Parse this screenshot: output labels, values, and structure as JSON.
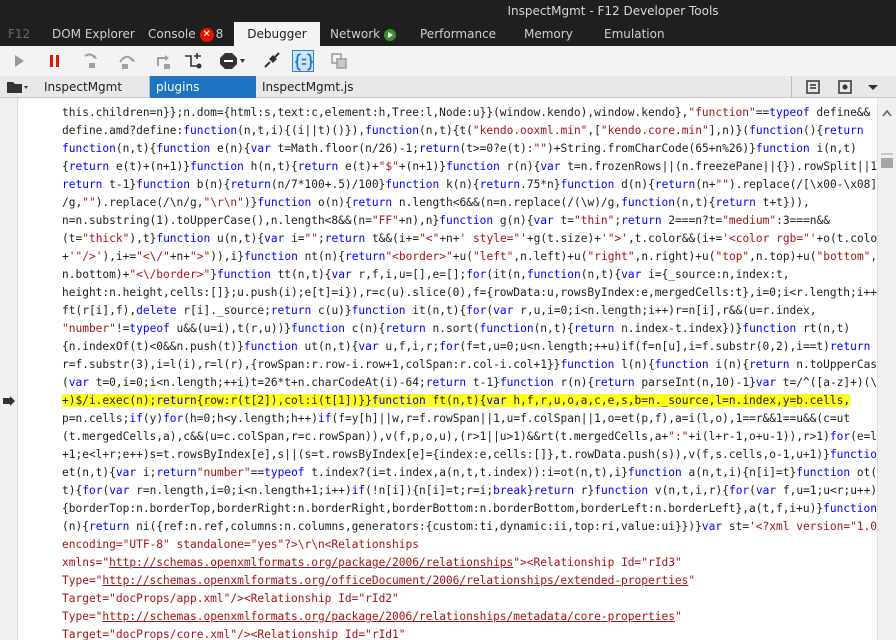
{
  "window": {
    "title": "InspectMgmt - F12 Developer Tools"
  },
  "tabs": [
    {
      "label": "F12"
    },
    {
      "label": "DOM Explorer"
    },
    {
      "label": "Console",
      "badge": "8"
    },
    {
      "label": "Debugger"
    },
    {
      "label": "Network"
    },
    {
      "label": "Performance"
    },
    {
      "label": "Memory"
    },
    {
      "label": "Emulation"
    }
  ],
  "toolbar": {
    "icons": [
      "play-icon",
      "pause-icon",
      "step-into-icon",
      "step-over-icon",
      "step-out-icon",
      "break-on-new-worker-icon",
      "exception-behavior-icon",
      "disconnect-icon",
      "pretty-print-icon",
      "source-map-icon"
    ]
  },
  "file_tabs": [
    {
      "label": "InspectMgmt"
    },
    {
      "label": "plugins"
    },
    {
      "label": "InspectMgmt.js"
    }
  ],
  "colors": {
    "accent": "#1e73c3",
    "highlight": "#ffff19",
    "keyword": "#0000ff",
    "string": "#a31515",
    "error": "#e51400"
  },
  "code_lines": [
    [
      [
        "t",
        "this.children=n}};n.dom={html:s,text:c,element:h,Tree:l,Node:u}}(window.kendo),window.kendo},"
      ],
      [
        "s",
        "\"function\""
      ],
      [
        "t",
        "=="
      ],
      [
        "k",
        "typeof"
      ],
      [
        "t",
        " define&&"
      ]
    ],
    [
      [
        "t",
        "define.amd?define:"
      ],
      [
        "k",
        "function"
      ],
      [
        "t",
        "(n,t,i){(i||t)()}),"
      ],
      [
        "k",
        "function"
      ],
      [
        "t",
        "(n,t){t("
      ],
      [
        "s",
        "\"kendo.ooxml.min\""
      ],
      [
        "t",
        ",["
      ],
      [
        "s",
        "\"kendo.core.min\""
      ],
      [
        "t",
        "],n)}("
      ],
      [
        "k",
        "function"
      ],
      [
        "t",
        "(){"
      ],
      [
        "k",
        "return"
      ]
    ],
    [
      [
        "k",
        "function"
      ],
      [
        "t",
        "(n,t){"
      ],
      [
        "k",
        "function"
      ],
      [
        "t",
        " e(n){"
      ],
      [
        "k",
        "var"
      ],
      [
        "t",
        " t=Math.floor(n/26)-1;"
      ],
      [
        "k",
        "return"
      ],
      [
        "t",
        "(t>=0?e(t):"
      ],
      [
        "s",
        "\"\""
      ],
      [
        "t",
        ")+String.fromCharCode(65+n%26)}"
      ],
      [
        "k",
        "function"
      ],
      [
        "t",
        " i(n,t)"
      ]
    ],
    [
      [
        "t",
        "{"
      ],
      [
        "k",
        "return"
      ],
      [
        "t",
        " e(t)+(n+1)}"
      ],
      [
        "k",
        "function"
      ],
      [
        "t",
        " h(n,t){"
      ],
      [
        "k",
        "return"
      ],
      [
        "t",
        " e(t)+"
      ],
      [
        "s",
        "\"$\""
      ],
      [
        "t",
        "+(n+1)}"
      ],
      [
        "k",
        "function"
      ],
      [
        "t",
        " r(n){"
      ],
      [
        "k",
        "var"
      ],
      [
        "t",
        " t=n.frozenRows||(n.freezePane||{}).rowSplit||1;"
      ]
    ],
    [
      [
        "k",
        "return"
      ],
      [
        "t",
        " t-1}"
      ],
      [
        "k",
        "function"
      ],
      [
        "t",
        " b(n){"
      ],
      [
        "k",
        "return"
      ],
      [
        "t",
        "(n/7*100+.5)/100}"
      ],
      [
        "k",
        "function"
      ],
      [
        "t",
        " k(n){"
      ],
      [
        "k",
        "return"
      ],
      [
        "t",
        ".75*n}"
      ],
      [
        "k",
        "function"
      ],
      [
        "t",
        " d(n){"
      ],
      [
        "k",
        "return"
      ],
      [
        "t",
        "(n+"
      ],
      [
        "s",
        "\"\""
      ],
      [
        "t",
        ").replace(/[\\x00-\\x08]"
      ]
    ],
    [
      [
        "t",
        "/g,"
      ],
      [
        "s",
        "\"\""
      ],
      [
        "t",
        ").replace(/\\n/g,"
      ],
      [
        "s",
        "\"\\r\\n\""
      ],
      [
        "t",
        ")}"
      ],
      [
        "k",
        "function"
      ],
      [
        "t",
        " o(n){"
      ],
      [
        "k",
        "return"
      ],
      [
        "t",
        " n.length<6&&(n=n.replace(/(\\w)/g,"
      ],
      [
        "k",
        "function"
      ],
      [
        "t",
        "(n,t){"
      ],
      [
        "k",
        "return"
      ],
      [
        "t",
        " t+t})),"
      ]
    ],
    [
      [
        "t",
        "n=n.substring(1).toUpperCase(),n.length<8&&(n="
      ],
      [
        "s",
        "\"FF\""
      ],
      [
        "t",
        "+n),n}"
      ],
      [
        "k",
        "function"
      ],
      [
        "t",
        " g(n){"
      ],
      [
        "k",
        "var"
      ],
      [
        "t",
        " t="
      ],
      [
        "s",
        "\"thin\""
      ],
      [
        "t",
        ";"
      ],
      [
        "k",
        "return"
      ],
      [
        "t",
        " 2===n?t="
      ],
      [
        "s",
        "\"medium\""
      ],
      [
        "t",
        ":3===n&&"
      ]
    ],
    [
      [
        "t",
        "(t="
      ],
      [
        "s",
        "\"thick\""
      ],
      [
        "t",
        "),t}"
      ],
      [
        "k",
        "function"
      ],
      [
        "t",
        " u(n,t){"
      ],
      [
        "k",
        "var"
      ],
      [
        "t",
        " i="
      ],
      [
        "s",
        "\"\""
      ],
      [
        "t",
        ";"
      ],
      [
        "k",
        "return"
      ],
      [
        "t",
        " t&&(i+="
      ],
      [
        "s",
        "\"<\""
      ],
      [
        "t",
        "+n+"
      ],
      [
        "s",
        "' style=\"'"
      ],
      [
        "t",
        "+g(t.size)+"
      ],
      [
        "s",
        "'\">'"
      ],
      [
        "t",
        ",t.color&&(i+="
      ],
      [
        "s",
        "'<color rgb=\"'"
      ],
      [
        "t",
        "+o(t.color)"
      ]
    ],
    [
      [
        "t",
        "+"
      ],
      [
        "s",
        "'\"/>'"
      ],
      [
        "t",
        "),i+="
      ],
      [
        "s",
        "\"<\\/\""
      ],
      [
        "t",
        "+n+"
      ],
      [
        "s",
        "\">\""
      ],
      [
        "t",
        ")),i}"
      ],
      [
        "k",
        "function"
      ],
      [
        "t",
        " nt(n){"
      ],
      [
        "k",
        "return"
      ],
      [
        "s",
        "\"<border>\""
      ],
      [
        "t",
        "+u("
      ],
      [
        "s",
        "\"left\""
      ],
      [
        "t",
        ",n.left)+u("
      ],
      [
        "s",
        "\"right\""
      ],
      [
        "t",
        ",n.right)+u("
      ],
      [
        "s",
        "\"top\""
      ],
      [
        "t",
        ",n.top)+u("
      ],
      [
        "s",
        "\"bottom\""
      ],
      [
        "t",
        ","
      ]
    ],
    [
      [
        "t",
        "n.bottom)+"
      ],
      [
        "s",
        "\"<\\/border>\""
      ],
      [
        "t",
        "}"
      ],
      [
        "k",
        "function"
      ],
      [
        "t",
        " tt(n,t){"
      ],
      [
        "k",
        "var"
      ],
      [
        "t",
        " r,f,i,u=[],e=[];"
      ],
      [
        "k",
        "for"
      ],
      [
        "t",
        "(it(n,"
      ],
      [
        "k",
        "function"
      ],
      [
        "t",
        "(n,t){"
      ],
      [
        "k",
        "var"
      ],
      [
        "t",
        " i={_source:n,index:t,"
      ]
    ],
    [
      [
        "t",
        "height:n.height,cells:[]};u.push(i);e[t]=i}),r=c(u).slice(0),f={rowData:u,rowsByIndex:e,mergedCells:t},i=0;i<r.length;i++)"
      ]
    ],
    [
      [
        "t",
        "ft(r[i],f),"
      ],
      [
        "k",
        "delete"
      ],
      [
        "t",
        " r[i]._source;"
      ],
      [
        "k",
        "return"
      ],
      [
        "t",
        " c(u)}"
      ],
      [
        "k",
        "function"
      ],
      [
        "t",
        " it(n,t){"
      ],
      [
        "k",
        "for"
      ],
      [
        "t",
        "("
      ],
      [
        "k",
        "var"
      ],
      [
        "t",
        " r,u,i=0;i<n.length;i++)r=n[i],r&&(u=r.index,"
      ]
    ],
    [
      [
        "s",
        "\"number\""
      ],
      [
        "t",
        "!="
      ],
      [
        "k",
        "typeof"
      ],
      [
        "t",
        " u&&(u=i),t(r,u))}"
      ],
      [
        "k",
        "function"
      ],
      [
        "t",
        " c(n){"
      ],
      [
        "k",
        "return"
      ],
      [
        "t",
        " n.sort("
      ],
      [
        "k",
        "function"
      ],
      [
        "t",
        "(n,t){"
      ],
      [
        "k",
        "return"
      ],
      [
        "t",
        " n.index-t.index})}"
      ],
      [
        "k",
        "function"
      ],
      [
        "t",
        " rt(n,t)"
      ]
    ],
    [
      [
        "t",
        "{n.indexOf(t)<0&&n.push(t)}"
      ],
      [
        "k",
        "function"
      ],
      [
        "t",
        " ut(n,t){"
      ],
      [
        "k",
        "var"
      ],
      [
        "t",
        " u,f,i,r;"
      ],
      [
        "k",
        "for"
      ],
      [
        "t",
        "(f=t,u=0;u<n.length;++u)if(f=n[u],i=f.substr(0,2),i==t)"
      ],
      [
        "k",
        "return"
      ]
    ],
    [
      [
        "t",
        "r=f.substr(3),i=l(i),r=l(r),{rowSpan:r.row-i.row+1,colSpan:r.col-i.col+1}}"
      ],
      [
        "k",
        "function"
      ],
      [
        "t",
        " l(n){"
      ],
      [
        "k",
        "function"
      ],
      [
        "t",
        " i(n){"
      ],
      [
        "k",
        "return"
      ],
      [
        "t",
        " n.toUpperCase();"
      ],
      [
        "k",
        "for"
      ]
    ],
    [
      [
        "t",
        "("
      ],
      [
        "k",
        "var"
      ],
      [
        "t",
        " t=0,i=0;i<n.length;++i)t=26*t+n.charCodeAt(i)-64;"
      ],
      [
        "k",
        "return"
      ],
      [
        "t",
        " t-1}"
      ],
      [
        "k",
        "function"
      ],
      [
        "t",
        " r(n){"
      ],
      [
        "k",
        "return"
      ],
      [
        "t",
        " parseInt(n,10)-1}"
      ],
      [
        "k",
        "var"
      ],
      [
        "t",
        " t=/^([a-z]+)(\\d"
      ]
    ],
    [
      [
        "h",
        "+)$/i.exec(n);"
      ],
      [
        "hk",
        "return"
      ],
      [
        "h",
        "{row:r(t[2]),col:i(t[1])}}"
      ],
      [
        "hk",
        "function"
      ],
      [
        "h",
        " ft(n,t){"
      ],
      [
        "hk",
        "var"
      ],
      [
        "h",
        " h,f,r,u,o,a,c,e,s,b=n._source,l=n.index,y=b.cells,"
      ]
    ],
    [
      [
        "t",
        "p=n.cells;"
      ],
      [
        "k",
        "if"
      ],
      [
        "t",
        "(y)"
      ],
      [
        "k",
        "for"
      ],
      [
        "t",
        "(h=0;h<y.length;h++)"
      ],
      [
        "k",
        "if"
      ],
      [
        "t",
        "(f=y[h]||w,r=f.rowSpan||1,u=f.colSpan||1,o=et(p,f),a=i(l,o),1==r&&1==u&&(c=ut"
      ]
    ],
    [
      [
        "t",
        "(t.mergedCells,a),c&&(u=c.colSpan,r=c.rowSpan)),v(f,p,o,u),(r>1||u>1)&&rt(t.mergedCells,a+"
      ],
      [
        "s",
        "\":\""
      ],
      [
        "t",
        "+i(l+r-1,o+u-1)),r>1)"
      ],
      [
        "k",
        "for"
      ],
      [
        "t",
        "(e=l"
      ]
    ],
    [
      [
        "t",
        "+1;e<l+r;e++)s=t.rowsByIndex[e],s||(s=t.rowsByIndex[e]={index:e,cells:[]},t.rowData.push(s)),v(f,s.cells,o-1,u+1)}"
      ],
      [
        "k",
        "function"
      ]
    ],
    [
      [
        "t",
        "et(n,t){"
      ],
      [
        "k",
        "var"
      ],
      [
        "t",
        " i;"
      ],
      [
        "k",
        "return"
      ],
      [
        "s",
        "\"number\""
      ],
      [
        "t",
        "=="
      ],
      [
        "k",
        "typeof"
      ],
      [
        "t",
        " t.index?(i=t.index,a(n,t,t.index)):i=ot(n,t),i}"
      ],
      [
        "k",
        "function"
      ],
      [
        "t",
        " a(n,t,i){n[i]=t}"
      ],
      [
        "k",
        "function"
      ],
      [
        "t",
        " ot(n,"
      ]
    ],
    [
      [
        "t",
        "t){"
      ],
      [
        "k",
        "for"
      ],
      [
        "t",
        "("
      ],
      [
        "k",
        "var"
      ],
      [
        "t",
        " r=n.length,i=0;i<n.length+1;i++)"
      ],
      [
        "k",
        "if"
      ],
      [
        "t",
        "(!n[i]){n[i]=t;r=i;"
      ],
      [
        "k",
        "break"
      ],
      [
        "t",
        "}"
      ],
      [
        "k",
        "return"
      ],
      [
        "t",
        " r}"
      ],
      [
        "k",
        "function"
      ],
      [
        "t",
        " v(n,t,i,r){"
      ],
      [
        "k",
        "for"
      ],
      [
        "t",
        "("
      ],
      [
        "k",
        "var"
      ],
      [
        "t",
        " f,u=1;u<r;u++)f="
      ]
    ],
    [
      [
        "t",
        "{borderTop:n.borderTop,borderRight:n.borderRight,borderBottom:n.borderBottom,borderLeft:n.borderLeft},a(t,f,i+u)}"
      ],
      [
        "k",
        "function"
      ],
      [
        "t",
        " f"
      ]
    ],
    [
      [
        "t",
        "(n){"
      ],
      [
        "k",
        "return"
      ],
      [
        "t",
        " ni({ref:n.ref,columns:n.columns,generators:{custom:ti,dynamic:ii,top:ri,value:ui}})}"
      ],
      [
        "k",
        "var"
      ],
      [
        "t",
        " st="
      ],
      [
        "s",
        "'<?xml version=\"1.0\""
      ]
    ],
    [
      [
        "s",
        "encoding=\"UTF-8\" standalone=\"yes\"?>\\r\\n<Relationships"
      ]
    ],
    [
      [
        "s",
        "xmlns=\""
      ],
      [
        "u",
        "http://schemas.openxmlformats.org/package/2006/relationships"
      ],
      [
        "s",
        "\"><Relationship Id=\"rId3\""
      ]
    ],
    [
      [
        "s",
        "Type=\""
      ],
      [
        "u",
        "http://schemas.openxmlformats.org/officeDocument/2006/relationships/extended-properties"
      ],
      [
        "s",
        "\""
      ]
    ],
    [
      [
        "s",
        "Target=\"docProps/app.xml\"/><Relationship Id=\"rId2\""
      ]
    ],
    [
      [
        "s",
        "Type=\""
      ],
      [
        "u",
        "http://schemas.openxmlformats.org/package/2006/relationships/metadata/core-properties"
      ],
      [
        "s",
        "\""
      ]
    ],
    [
      [
        "s",
        "Target=\"docProps/core.xml\"/><Relationship Id=\"rId1\""
      ]
    ]
  ]
}
